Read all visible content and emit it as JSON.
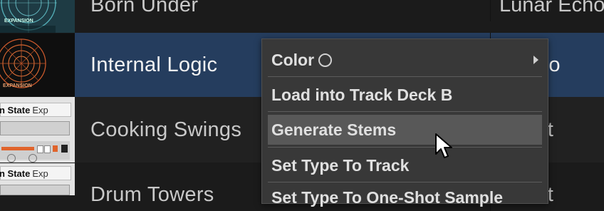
{
  "tracks": [
    {
      "title": "Born Under",
      "artist": "Lunar Echo"
    },
    {
      "title": "Internal Logic",
      "artist": "ner Bo"
    },
    {
      "title": "Cooking Swings",
      "artist": "n Stat"
    },
    {
      "title": "",
      "artist": ""
    },
    {
      "title": "Drum Towers",
      "artist": "n Stat"
    }
  ],
  "thumbnails": {
    "expansion_label": "EXPANSION",
    "pack_label": "n State",
    "pack_suffix": "Exp"
  },
  "context_menu": {
    "items": [
      {
        "label": "Color",
        "icon": "circle-icon",
        "submenu": true
      },
      {
        "label": "Load into Track Deck B"
      },
      {
        "label": "Generate Stems"
      },
      {
        "label": "Set Type To Track"
      },
      {
        "label": "Set Type To One-Shot Sample"
      }
    ]
  },
  "colors": {
    "selected_row": "#253d5e",
    "menu_background": "#383838",
    "menu_hover": "#585858",
    "text_primary": "#f2f2f2"
  }
}
